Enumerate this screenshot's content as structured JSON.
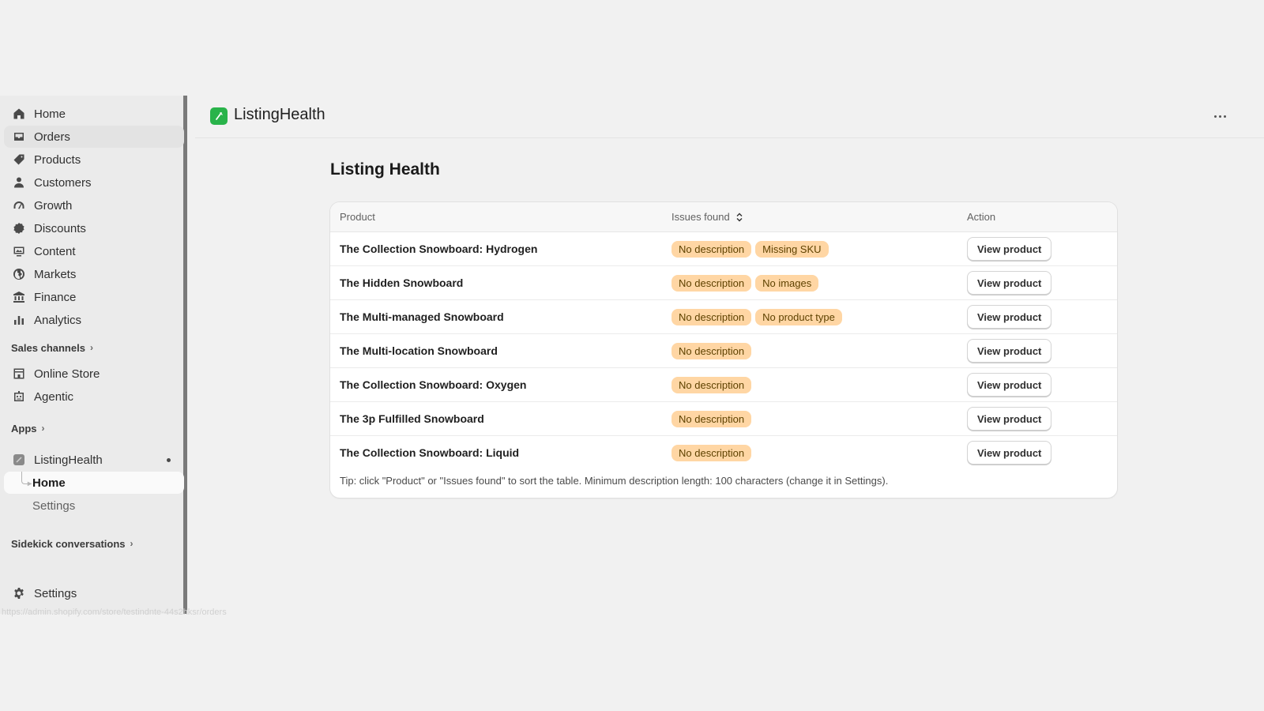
{
  "sidebar": {
    "nav": [
      {
        "label": "Home",
        "icon": "home-icon"
      },
      {
        "label": "Orders",
        "icon": "inbox-icon"
      },
      {
        "label": "Products",
        "icon": "tag-icon"
      },
      {
        "label": "Customers",
        "icon": "person-icon"
      },
      {
        "label": "Growth",
        "icon": "gauge-icon"
      },
      {
        "label": "Discounts",
        "icon": "discount-icon"
      },
      {
        "label": "Content",
        "icon": "content-icon"
      },
      {
        "label": "Markets",
        "icon": "globe-icon"
      },
      {
        "label": "Finance",
        "icon": "bank-icon"
      },
      {
        "label": "Analytics",
        "icon": "bar-chart-icon"
      }
    ],
    "sales_channels_label": "Sales channels",
    "channels": [
      {
        "label": "Online Store",
        "icon": "store-icon"
      },
      {
        "label": "Agentic",
        "icon": "agent-icon"
      }
    ],
    "apps_label": "Apps",
    "app": {
      "label": "ListingHealth",
      "children": [
        "Home",
        "Settings"
      ]
    },
    "sidekick_label": "Sidekick conversations",
    "settings_label": "Settings",
    "status_url": "https://admin.shopify.com/store/testindnte-44s2hksr/orders"
  },
  "header": {
    "app_name": "ListingHealth",
    "brand_color": "#29b34a"
  },
  "main": {
    "title": "Listing Health",
    "columns": {
      "product": "Product",
      "issues": "Issues found",
      "action": "Action"
    },
    "rows": [
      {
        "product": "The Collection Snowboard: Hydrogen",
        "issues": [
          "No description",
          "Missing SKU"
        ],
        "action": "View product"
      },
      {
        "product": "The Hidden Snowboard",
        "issues": [
          "No description",
          "No images"
        ],
        "action": "View product"
      },
      {
        "product": "The Multi-managed Snowboard",
        "issues": [
          "No description",
          "No product type"
        ],
        "action": "View product"
      },
      {
        "product": "The Multi-location Snowboard",
        "issues": [
          "No description"
        ],
        "action": "View product"
      },
      {
        "product": "The Collection Snowboard: Oxygen",
        "issues": [
          "No description"
        ],
        "action": "View product"
      },
      {
        "product": "The 3p Fulfilled Snowboard",
        "issues": [
          "No description"
        ],
        "action": "View product"
      },
      {
        "product": "The Collection Snowboard: Liquid",
        "issues": [
          "No description"
        ],
        "action": "View product"
      }
    ],
    "tip": "Tip: click \"Product\" or \"Issues found\" to sort the table. Minimum description length: 100 characters (change it in Settings).",
    "badge_color": "#ffd6a4"
  }
}
